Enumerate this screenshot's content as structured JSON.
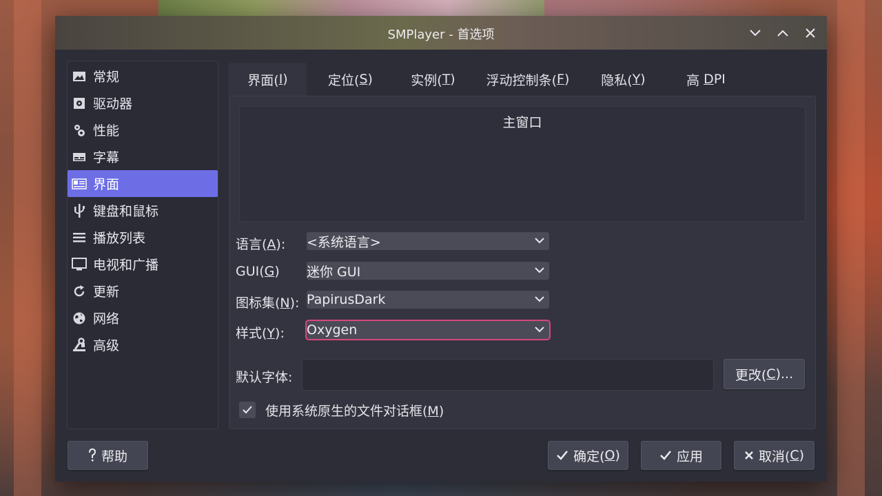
{
  "window": {
    "title": "SMPlayer - 首选项"
  },
  "sidebar": {
    "items": [
      {
        "label": "常规",
        "icon": "image-icon"
      },
      {
        "label": "驱动器",
        "icon": "drive-icon"
      },
      {
        "label": "性能",
        "icon": "gears-icon"
      },
      {
        "label": "字幕",
        "icon": "subtitles-icon"
      },
      {
        "label": "界面",
        "icon": "interface-icon",
        "selected": true
      },
      {
        "label": "键盘和鼠标",
        "icon": "usb-icon"
      },
      {
        "label": "播放列表",
        "icon": "list-icon"
      },
      {
        "label": "电视和广播",
        "icon": "monitor-icon"
      },
      {
        "label": "更新",
        "icon": "refresh-icon"
      },
      {
        "label": "网络",
        "icon": "globe-icon"
      },
      {
        "label": "高级",
        "icon": "tools-icon"
      }
    ]
  },
  "tabs": [
    {
      "pre": "界面(",
      "key": "I",
      "post": ")"
    },
    {
      "pre": "定位(",
      "key": "S",
      "post": ")"
    },
    {
      "pre": "实例(",
      "key": "T",
      "post": ")"
    },
    {
      "pre": "浮动控制条(",
      "key": "F",
      "post": ")"
    },
    {
      "pre": "隐私(",
      "key": "Y",
      "post": ")"
    },
    {
      "pre": "高 ",
      "key": "D",
      "post": "PI"
    }
  ],
  "main_window_group": {
    "title": "主窗口"
  },
  "fields": {
    "language": {
      "label_pre": "语言(",
      "label_key": "A",
      "label_post": "):",
      "value": "<系统语言>"
    },
    "gui": {
      "label_pre": "GUI(",
      "label_key": "G",
      "label_post": ")",
      "value": "迷你 GUI"
    },
    "iconset": {
      "label_pre": "图标集(",
      "label_key": "N",
      "label_post": "):",
      "value": "PapirusDark"
    },
    "style": {
      "label_pre": "样式(",
      "label_key": "Y",
      "label_post": "):",
      "value": "Oxygen"
    }
  },
  "default_font": {
    "label": "默认字体:",
    "value": "",
    "change_button": {
      "pre": "更改(",
      "key": "C",
      "post": ")..."
    }
  },
  "native_dialog": {
    "checked": true,
    "label_pre": "使用系统原生的文件对话框(",
    "label_key": "M",
    "label_post": ")"
  },
  "footer": {
    "help": "帮助",
    "ok": {
      "pre": "确定(",
      "key": "O",
      "post": ")"
    },
    "apply": "应用",
    "cancel": {
      "pre": "取消(",
      "key": "C",
      "post": ")"
    }
  },
  "colors": {
    "accent": "#6d6ee6",
    "focus": "#d9467c",
    "window_bg": "#2c2d37"
  }
}
